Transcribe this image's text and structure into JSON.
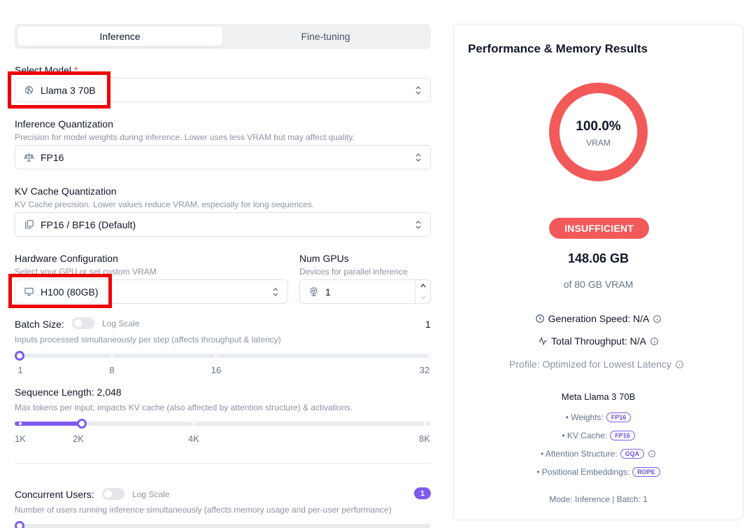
{
  "tabs": [
    {
      "label": "Inference",
      "active": true
    },
    {
      "label": "Fine-tuning",
      "active": false
    }
  ],
  "model": {
    "label": "Select Model",
    "required_mark": "*",
    "value": "Llama 3 70B",
    "icon": "openai-like-model-icon"
  },
  "inference_quant": {
    "label": "Inference Quantization",
    "hint": "Precision for model weights during inference. Lower uses less VRAM but may affect quality.",
    "value": "FP16",
    "icon": "scale-icon"
  },
  "kv_quant": {
    "label": "KV Cache Quantization",
    "hint": "KV Cache precision. Lower values reduce VRAM, especially for long sequences.",
    "value": "FP16 / BF16 (Default)",
    "icon": "layers-icon"
  },
  "hardware": {
    "label": "Hardware Configuration",
    "hint": "Select your GPU or set custom VRAM",
    "value": "H100 (80GB)",
    "icon": "monitor-icon"
  },
  "num_gpus": {
    "label": "Num GPUs",
    "hint": "Devices for parallel inference",
    "value": "1",
    "icon": "webcam-icon"
  },
  "batch": {
    "label": "Batch Size:",
    "log_scale_label": "Log Scale",
    "value": "1",
    "hint": "Inputs processed simultaneously per step (affects throughput & latency)",
    "ticks": [
      "1",
      "8",
      "16",
      "32"
    ],
    "fraction": 0.0
  },
  "sequence": {
    "label": "Sequence Length: 2,048",
    "hint": "Max tokens per input; impacts KV cache (also affected by attention structure) & activations.",
    "ticks": [
      "1K",
      "2K",
      "4K",
      "8K"
    ],
    "fraction": 0.1525
  },
  "concurrent": {
    "label": "Concurrent Users:",
    "log_scale_label": "Log Scale",
    "value": "1",
    "hint": "Number of users running inference simultaneously (affects memory usage and per-user performance)"
  },
  "results": {
    "title": "Performance & Memory Results",
    "vram_percent": "100.0%",
    "vram_label": "VRAM",
    "status": "INSUFFICIENT",
    "memory": "148.06 GB",
    "memory_of": "of 80 GB VRAM",
    "generation_speed": "Generation Speed: N/A",
    "total_throughput": "Total Throughput: N/A",
    "profile": "Profile: Optimized for Lowest Latency",
    "model_name": "Meta Llama 3 70B",
    "weights_label": "• Weights:",
    "weights_value": "FP16",
    "kv_label": "• KV Cache:",
    "kv_value": "FP16",
    "attn_label": "• Attention Structure:",
    "attn_value": "GQA",
    "pos_label": "• Positional Embeddings:",
    "pos_value": "ROPE",
    "mode": "Mode: Inference | Batch: 1"
  },
  "colors": {
    "accent": "#7c5cf0",
    "danger": "#f25a5a",
    "highlight_box": "#ee0000"
  }
}
